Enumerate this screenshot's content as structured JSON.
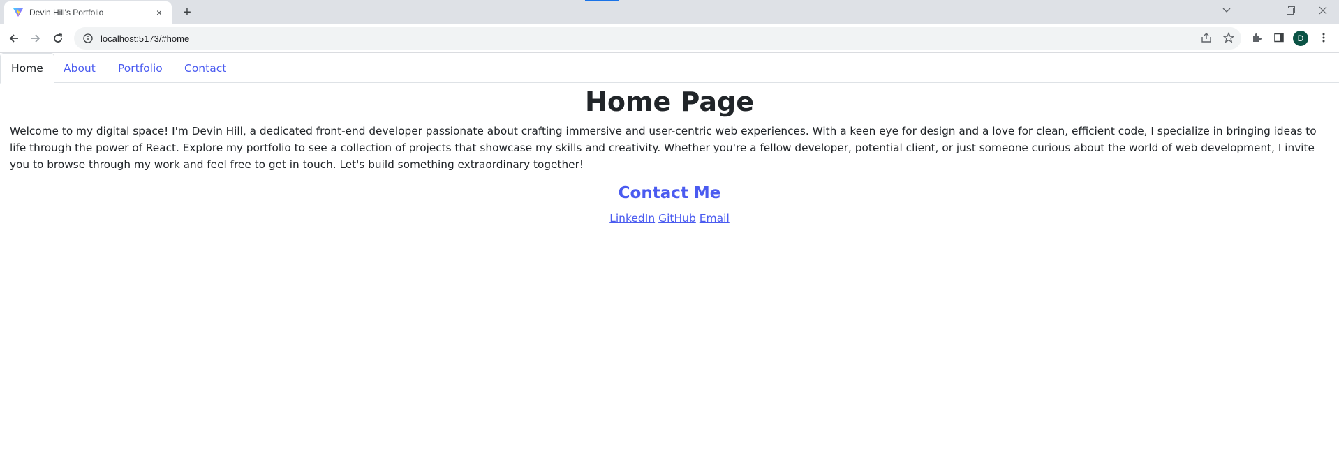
{
  "browser": {
    "tab_title": "Devin Hill's Portfolio",
    "tab_close": "×",
    "new_tab": "+",
    "url": "localhost:5173/#home",
    "profile_initial": "D"
  },
  "nav": {
    "tabs": [
      {
        "label": "Home",
        "active": true
      },
      {
        "label": "About",
        "active": false
      },
      {
        "label": "Portfolio",
        "active": false
      },
      {
        "label": "Contact",
        "active": false
      }
    ]
  },
  "main": {
    "title": "Home Page",
    "intro": "Welcome to my digital space! I'm Devin Hill, a dedicated front-end developer passionate about crafting immersive and user-centric web experiences. With a keen eye for design and a love for clean, efficient code, I specialize in bringing ideas to life through the power of React. Explore my portfolio to see a collection of projects that showcase my skills and creativity. Whether you're a fellow developer, potential client, or just someone curious about the world of web development, I invite you to browse through my work and feel free to get in touch. Let's build something extraordinary together!",
    "contact_heading": "Contact Me",
    "links": [
      "LinkedIn",
      "GitHub",
      "Email"
    ]
  },
  "colors": {
    "accent": "#4a5bf0",
    "text": "#212529",
    "tabstrip": "#dee1e6",
    "avatar": "#0b5345"
  }
}
